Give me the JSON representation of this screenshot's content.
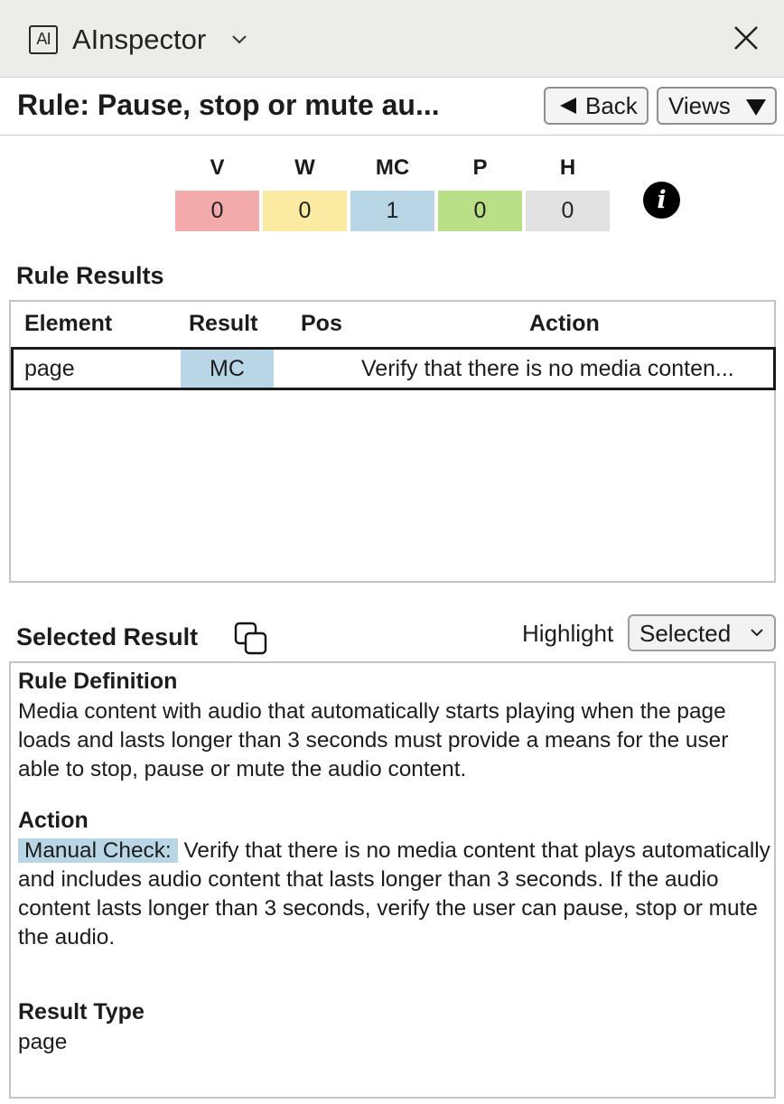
{
  "titlebar": {
    "logo_text": "AI",
    "app_name": "AInspector"
  },
  "rule": {
    "title": "Rule: Pause, stop or mute au..."
  },
  "toolbar": {
    "back_label": "Back",
    "views_label": "Views"
  },
  "colors": {
    "violation": "#f3aaaa",
    "warning": "#fbeba2",
    "manual_check": "#b9d6e6",
    "passed": "#b9e087",
    "hidden": "#e1e1e1"
  },
  "summary": [
    {
      "label": "V",
      "value": "0"
    },
    {
      "label": "W",
      "value": "0"
    },
    {
      "label": "MC",
      "value": "1"
    },
    {
      "label": "P",
      "value": "0"
    },
    {
      "label": "H",
      "value": "0"
    }
  ],
  "rule_results": {
    "heading": "Rule Results",
    "columns": [
      "Element",
      "Result",
      "Pos",
      "Action"
    ],
    "rows": [
      {
        "element": "page",
        "result": "MC",
        "pos": "",
        "action": "Verify that there is no media conten..."
      }
    ]
  },
  "selected_result": {
    "heading": "Selected Result",
    "highlight_label": "Highlight",
    "highlight_value": "Selected",
    "rule_definition_heading": "Rule Definition",
    "rule_definition_text": "Media content with audio that automatically starts playing when the page loads and lasts longer than 3 seconds must provide a means for the user able to stop, pause or mute the audio content.",
    "action_heading": "Action",
    "action_tag": "Manual Check:",
    "action_text": "Verify that there is no media content that plays automatically and includes audio content that lasts longer than 3 seconds. If the audio content lasts longer than 3 seconds, verify the user can pause, stop or mute the audio.",
    "result_type_heading": "Result Type",
    "result_type_value": "page"
  }
}
